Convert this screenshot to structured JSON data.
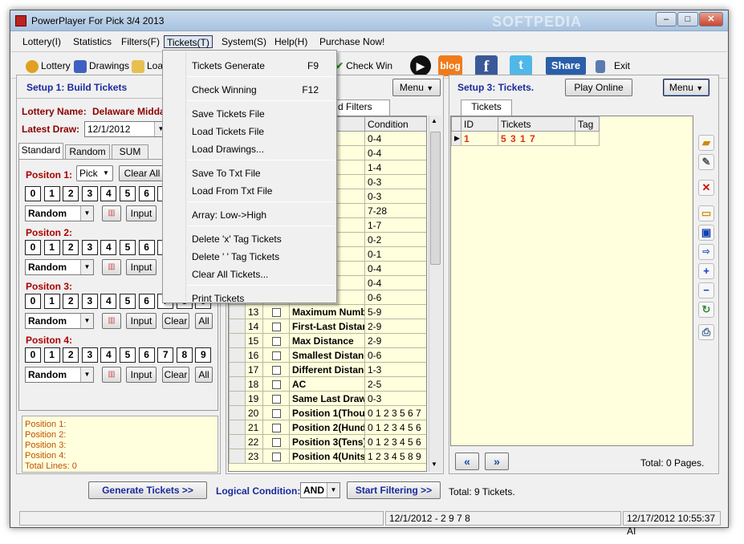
{
  "window": {
    "title": "PowerPlayer For Pick 3/4 2013",
    "watermark": "SOFTPEDIA"
  },
  "menu": [
    "Lottery(I)",
    "Statistics",
    "Filters(F)",
    "Tickets(T)",
    "System(S)",
    "Help(H)",
    "Purchase  Now!"
  ],
  "toolbar": {
    "lottery": "Lottery",
    "drawings": "Drawings",
    "loa": "Loa",
    "check_win": "Check Win",
    "blog": "blog",
    "share": "Share",
    "exit": "Exit"
  },
  "dropdown": [
    {
      "label": "Tickets Generate",
      "key": "F9"
    },
    {
      "label": "Check Winning",
      "key": "F12"
    },
    {
      "label": "Save Tickets File",
      "key": ""
    },
    {
      "label": "Load Tickets File",
      "key": ""
    },
    {
      "label": "Load Drawings...",
      "key": ""
    },
    {
      "label": "Save To Txt File",
      "key": ""
    },
    {
      "label": "Load From Txt File",
      "key": ""
    },
    {
      "label": "Array: Low->High",
      "key": ""
    },
    {
      "label": "Delete 'x' Tag Tickets",
      "key": ""
    },
    {
      "label": "Delete  ' ' Tag Tickets",
      "key": ""
    },
    {
      "label": "Clear All Tickets...",
      "key": ""
    },
    {
      "label": "Print Tickets",
      "key": ""
    }
  ],
  "left": {
    "header": "Setup 1: Build  Tickets",
    "lottery_label": "Lottery  Name:",
    "lottery_name": "Delaware Midda",
    "latest_label": "Latest Draw:",
    "latest_value": "12/1/2012",
    "tabs": [
      "Standard",
      "Random",
      "SUM"
    ],
    "pos1": "Positon 1:",
    "pick": "Pick",
    "clear_all": "Clear All",
    "pos2": "Positon 2:",
    "pos3": "Positon 3:",
    "pos4": "Positon 4:",
    "digits": [
      "0",
      "1",
      "2",
      "3",
      "4",
      "5",
      "6",
      "7",
      "8",
      "9"
    ],
    "random": "Random",
    "input": "Input",
    "clear": "Clear",
    "all": "All",
    "summary": [
      "Position 1:",
      "Position 2:",
      "Position 3:",
      "Position 4:",
      "Total Lines: 0"
    ]
  },
  "middle": {
    "menu_btn": "Menu",
    "tab_label": "d Filters",
    "condition_header": "Condition",
    "top_rows": [
      {
        "name": "nt",
        "cond": "0-4"
      },
      {
        "name": "nt",
        "cond": "0-4"
      },
      {
        "name": "nt",
        "cond": "1-4"
      },
      {
        "name": "nt",
        "cond": "0-3"
      },
      {
        "name": "unt",
        "cond": "0-3"
      },
      {
        "name": "um",
        "cond": "7-28"
      },
      {
        "name": "Value",
        "cond": "1-7"
      },
      {
        "name": "ve",
        "cond": "0-2"
      },
      {
        "name": "ve Gro",
        "cond": "0-1"
      },
      {
        "name": "cessive",
        "cond": "0-4"
      },
      {
        "name": "ccessive",
        "cond": "0-4"
      },
      {
        "name": "Numbe",
        "cond": "0-6"
      }
    ],
    "rows": [
      {
        "id": "13",
        "name": "Maximum Numbe",
        "cond": "5-9"
      },
      {
        "id": "14",
        "name": "First-Last Distan",
        "cond": "2-9"
      },
      {
        "id": "15",
        "name": "Max Distance",
        "cond": "2-9"
      },
      {
        "id": "16",
        "name": "Smallest Distanc",
        "cond": "0-6"
      },
      {
        "id": "17",
        "name": "Different Distanc",
        "cond": "1-3"
      },
      {
        "id": "18",
        "name": "AC",
        "cond": "2-5"
      },
      {
        "id": "19",
        "name": "Same Last Draw",
        "cond": "0-3"
      },
      {
        "id": "20",
        "name": "Position 1(Thou",
        "cond": "0 1 2 3 5 6 7"
      },
      {
        "id": "21",
        "name": "Position 2(Hund",
        "cond": "0 1 2 3 4 5 6"
      },
      {
        "id": "22",
        "name": "Position 3(Tens)",
        "cond": "0 1 2 3 4 5 6"
      },
      {
        "id": "23",
        "name": "Position 4(Units",
        "cond": "1 2 3 4 5 8 9"
      }
    ]
  },
  "right": {
    "header": "Setup 3: Tickets.",
    "play_online": "Play Online",
    "menu_btn": "Menu",
    "tab": "Tickets",
    "col_id": "ID",
    "col_tickets": "Tickets",
    "col_tag": "Tag",
    "row_id": "1",
    "row_ticket": "5 3 1 7",
    "total_pages": "Total: 0 Pages."
  },
  "bottom": {
    "generate": "Generate Tickets >>",
    "logical": "Logical Condition:",
    "and": "AND",
    "start": "Start Filtering  >>",
    "total": "Total: 9 Tickets."
  },
  "status": {
    "s1": "",
    "s2": "12/1/2012 - 2 9 7 8",
    "s3": "12/17/2012 10:55:37 AI"
  }
}
